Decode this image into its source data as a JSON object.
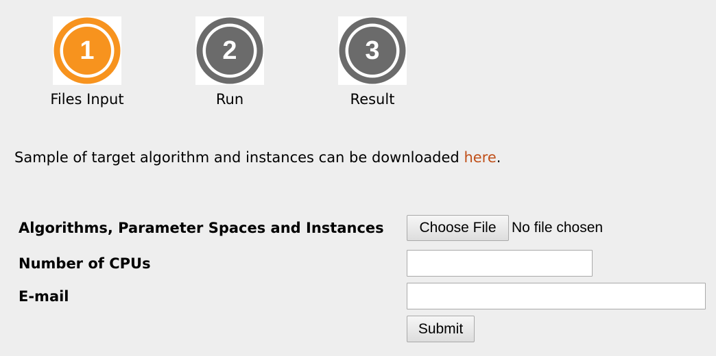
{
  "steps": [
    {
      "number": "1",
      "label": "Files Input",
      "color": "#f7931e",
      "active": true
    },
    {
      "number": "2",
      "label": "Run",
      "color": "#6b6b6b",
      "active": false
    },
    {
      "number": "3",
      "label": "Result",
      "color": "#6b6b6b",
      "active": false
    }
  ],
  "intro": {
    "text_before": "Sample of target algorithm and instances can be downloaded ",
    "link_text": "here",
    "text_after": "."
  },
  "form": {
    "algorithms_label": "Algorithms, Parameter Spaces and Instances",
    "choose_file_label": "Choose File",
    "file_status": "No file chosen",
    "cpus_label": "Number of CPUs",
    "cpus_value": "",
    "email_label": "E-mail",
    "email_value": "",
    "submit_label": "Submit"
  },
  "colors": {
    "background": "#eeeeee",
    "link": "#c0501a",
    "active_step": "#f7931e",
    "inactive_step": "#6b6b6b"
  }
}
